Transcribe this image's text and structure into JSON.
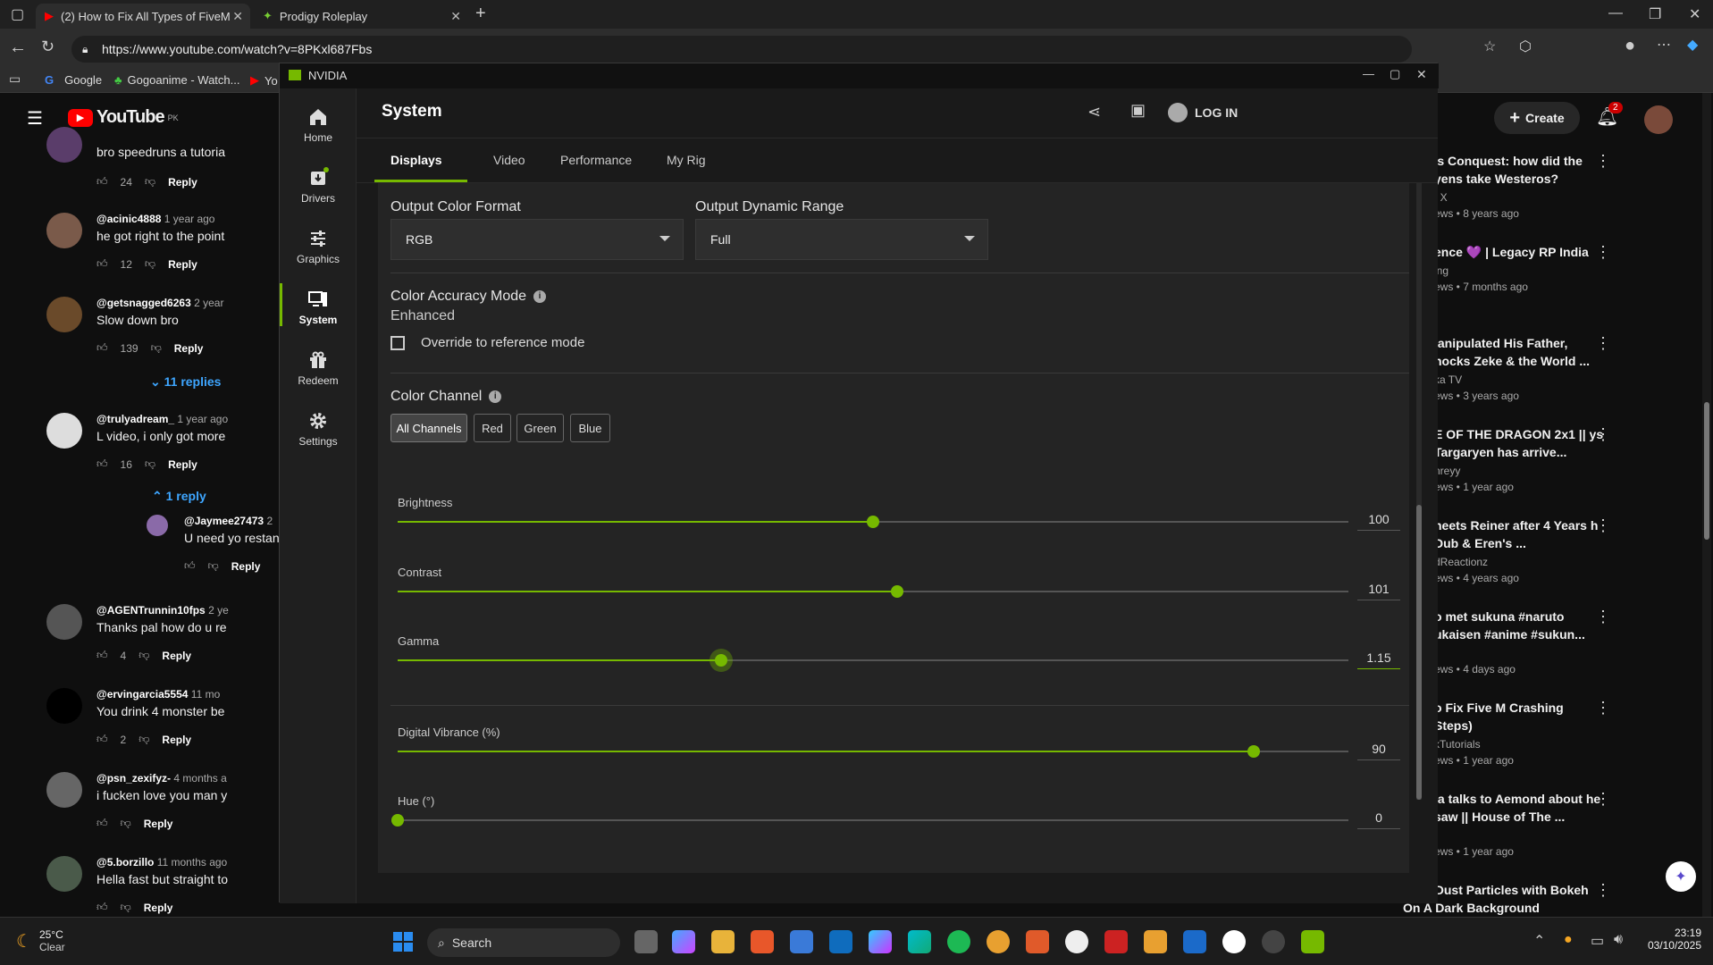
{
  "browser": {
    "tabs": [
      {
        "label": "(2) How to Fix All Types of FiveM"
      },
      {
        "label": "Prodigy Roleplay"
      }
    ],
    "url": "https://www.youtube.com/watch?v=8PKxl687Fbs",
    "favorites": [
      "Google",
      "Gogoanime - Watch...",
      "Yo"
    ]
  },
  "youtube": {
    "logo": "YouTube",
    "country": "PK",
    "create_label": "Create",
    "notif_count": "2",
    "comments": [
      {
        "user": "",
        "age": "",
        "text": "bro speedruns a tutoria",
        "likes": "24"
      },
      {
        "user": "@acinic4888",
        "age": "1 year ago",
        "text": "he got right to the point",
        "likes": "12"
      },
      {
        "user": "@getsnagged6263",
        "age": "2 year",
        "text": "Slow down bro",
        "likes": "139"
      },
      {
        "user": "@trulyadream_",
        "age": "1 year ago",
        "text": "L video, i only got more",
        "likes": "16"
      },
      {
        "user": "@Jaymee27473",
        "age": "2",
        "text": "U need yo restan",
        "likes": ""
      },
      {
        "user": "@AGENTrunnin10fps",
        "age": "2 ye",
        "text": "Thanks pal how do u re",
        "likes": "4"
      },
      {
        "user": "@ervingarcia5554",
        "age": "11 mo",
        "text": "You drink 4 monster be",
        "likes": "2"
      },
      {
        "user": "@psn_zexifyz-",
        "age": "4 months a",
        "text": "i fucken love you man y",
        "likes": ""
      },
      {
        "user": "@5.borzillo",
        "age": "11 months ago",
        "text": "Hella fast but straight to",
        "likes": ""
      }
    ],
    "reply_label": "Reply",
    "replies_11": "11 replies",
    "replies_1": "1 reply",
    "recommended": [
      {
        "title": "'s Conquest: how did the yens take Westeros?",
        "channel": "t X",
        "meta": "ews • 8 years ago"
      },
      {
        "title": "ence 💜 | Legacy RP India",
        "channel": "ing",
        "meta": "ews • 7 months ago"
      },
      {
        "title": "lanipulated His Father, hocks Zeke & the World ...",
        "channel": "ka TV",
        "meta": "ews • 3 years ago"
      },
      {
        "title": "E OF THE DRAGON 2x1 || ys Targaryen has arrive...",
        "channel": "nreyy",
        "meta": "ews • 1 year ago"
      },
      {
        "title": "heets Reiner after 4 Years h Dub & Eren's ...",
        "channel": "dReactionz",
        "meta": "ews • 4 years ago"
      },
      {
        "title": "o met sukuna #naruto ukaisen #anime #sukun...",
        "channel": "",
        "meta": "ews • 4 days ago"
      },
      {
        "title": "o Fix Five M Crashing Steps)",
        "channel": "kTutorials",
        "meta": "ews • 1 year ago"
      },
      {
        "title": "ia talks to Aemond about he saw || House of The ...",
        "channel": "",
        "meta": "ews • 1 year ago"
      },
      {
        "title": "Gold Dust Particles with Bokeh On A Dark Background",
        "channel": "",
        "meta": ""
      }
    ]
  },
  "nvidia": {
    "window_title": "NVIDIA",
    "page_title": "System",
    "login_label": "LOG IN",
    "nav": [
      {
        "label": "Home",
        "icon": "home-icon"
      },
      {
        "label": "Drivers",
        "icon": "drivers-icon"
      },
      {
        "label": "Graphics",
        "icon": "sliders-icon"
      },
      {
        "label": "System",
        "icon": "system-icon"
      },
      {
        "label": "Redeem",
        "icon": "gift-icon"
      },
      {
        "label": "Settings",
        "icon": "gear-icon"
      }
    ],
    "tabs": [
      "Displays",
      "Video",
      "Performance",
      "My Rig"
    ],
    "output_color_format": {
      "label": "Output Color Format",
      "value": "RGB"
    },
    "output_dynamic_range": {
      "label": "Output Dynamic Range",
      "value": "Full"
    },
    "color_accuracy": {
      "label": "Color Accuracy Mode",
      "value": "Enhanced",
      "override_label": "Override to reference mode"
    },
    "color_channel": {
      "label": "Color Channel",
      "buttons": [
        "All Channels",
        "Red",
        "Green",
        "Blue"
      ]
    },
    "sliders": [
      {
        "label": "Brightness",
        "value": "100",
        "fraction": 0.5
      },
      {
        "label": "Contrast",
        "value": "101",
        "fraction": 0.525
      },
      {
        "label": "Gamma",
        "value": "1.15",
        "fraction": 0.34
      },
      {
        "label": "Digital Vibrance (%)",
        "value": "90",
        "fraction": 0.9
      },
      {
        "label": "Hue (°)",
        "value": "0",
        "fraction": 0.0
      }
    ],
    "accent": "#76b900"
  },
  "taskbar": {
    "temp": "25°C",
    "weather": "Clear",
    "search": "Search",
    "time": "23:19",
    "date": "03/10/2025"
  }
}
